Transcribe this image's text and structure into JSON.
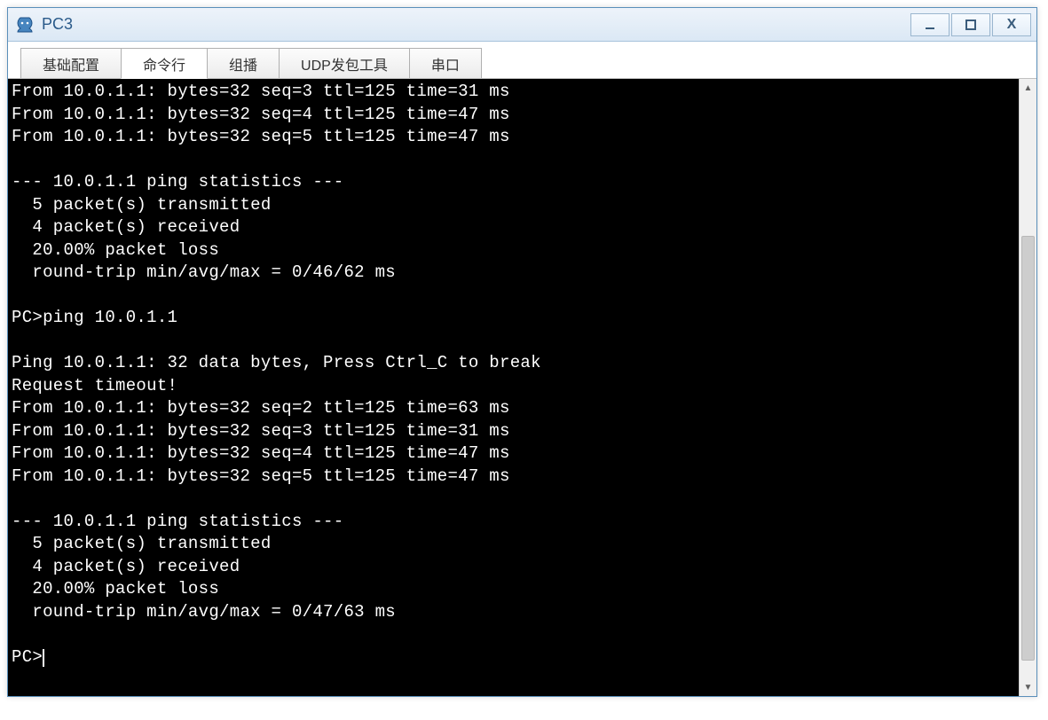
{
  "window": {
    "title": "PC3"
  },
  "tabs": [
    {
      "label": "基础配置",
      "active": false
    },
    {
      "label": "命令行",
      "active": true
    },
    {
      "label": "组播",
      "active": false
    },
    {
      "label": "UDP发包工具",
      "active": false
    },
    {
      "label": "串口",
      "active": false
    }
  ],
  "terminal": {
    "lines": [
      "From 10.0.1.1: bytes=32 seq=3 ttl=125 time=31 ms",
      "From 10.0.1.1: bytes=32 seq=4 ttl=125 time=47 ms",
      "From 10.0.1.1: bytes=32 seq=5 ttl=125 time=47 ms",
      "",
      "--- 10.0.1.1 ping statistics ---",
      "  5 packet(s) transmitted",
      "  4 packet(s) received",
      "  20.00% packet loss",
      "  round-trip min/avg/max = 0/46/62 ms",
      "",
      "PC>ping 10.0.1.1",
      "",
      "Ping 10.0.1.1: 32 data bytes, Press Ctrl_C to break",
      "Request timeout!",
      "From 10.0.1.1: bytes=32 seq=2 ttl=125 time=63 ms",
      "From 10.0.1.1: bytes=32 seq=3 ttl=125 time=31 ms",
      "From 10.0.1.1: bytes=32 seq=4 ttl=125 time=47 ms",
      "From 10.0.1.1: bytes=32 seq=5 ttl=125 time=47 ms",
      "",
      "--- 10.0.1.1 ping statistics ---",
      "  5 packet(s) transmitted",
      "  4 packet(s) received",
      "  20.00% packet loss",
      "  round-trip min/avg/max = 0/47/63 ms",
      ""
    ],
    "prompt": "PC>"
  },
  "controls": {
    "minimize": "—",
    "maximize": "□",
    "close": "X"
  },
  "scroll": {
    "thumb_top_pct": 24,
    "thumb_height_pct": 73
  }
}
